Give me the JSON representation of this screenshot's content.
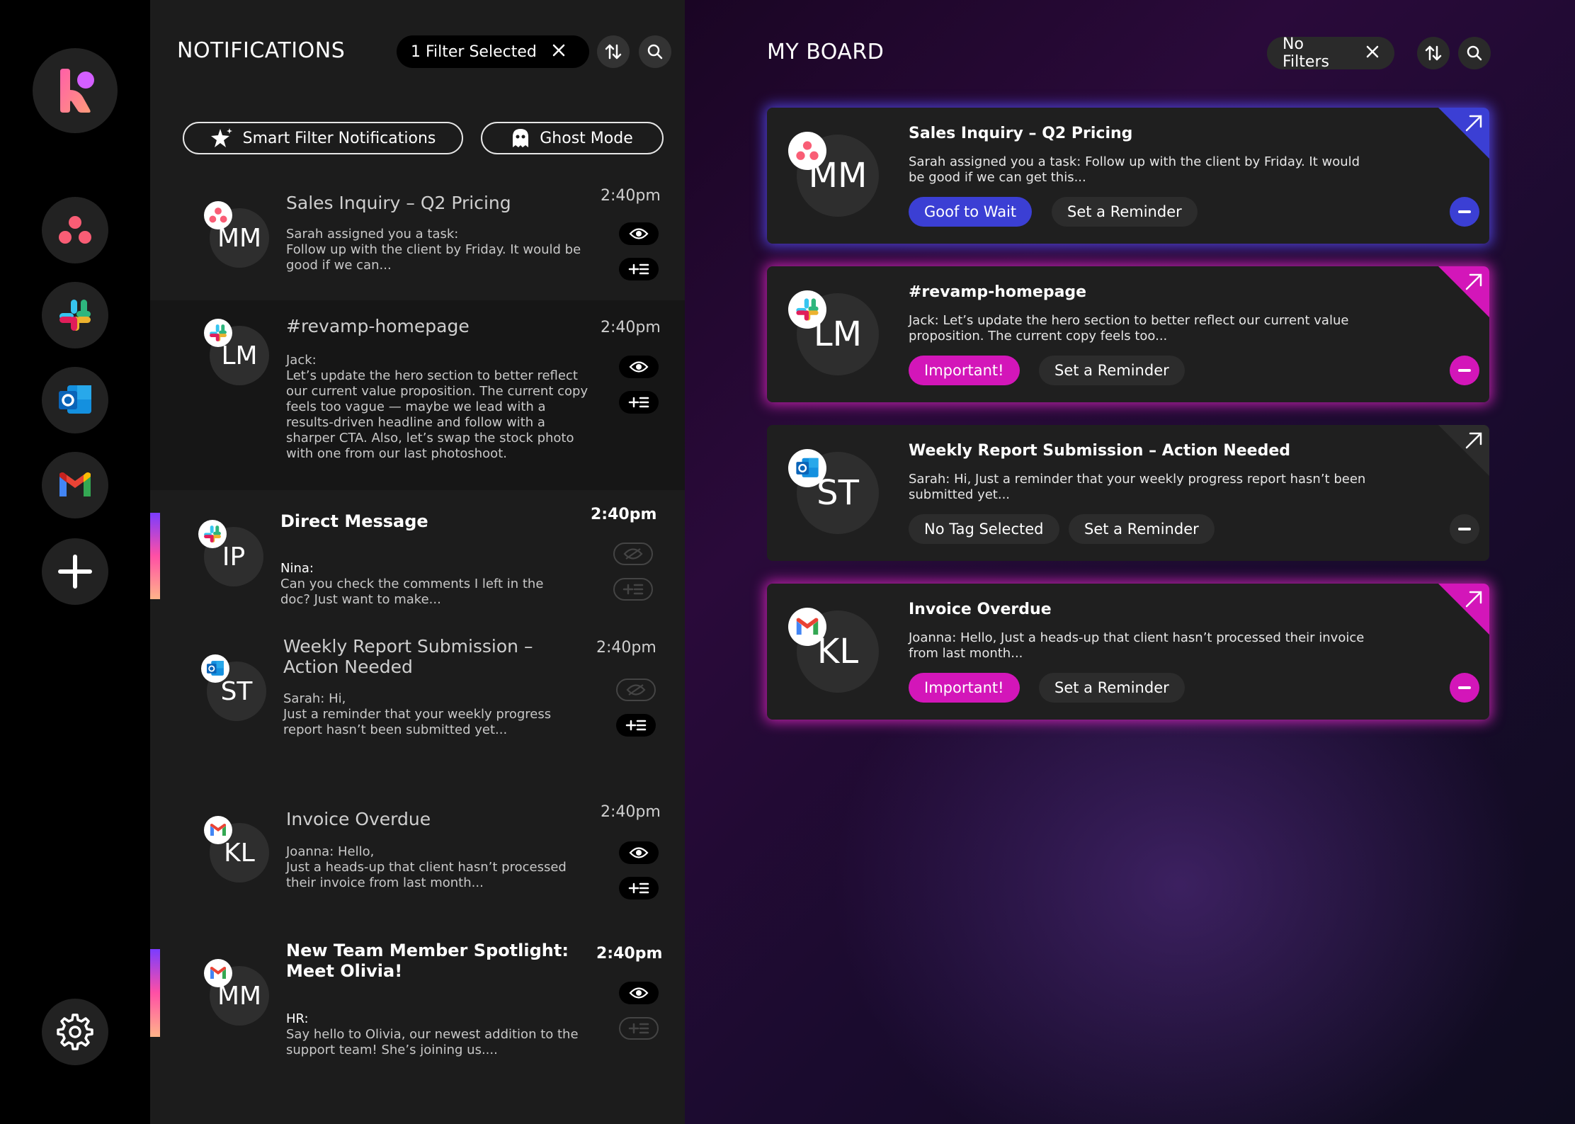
{
  "rail": {
    "apps": [
      "asana-icon",
      "slack-icon",
      "outlook-icon",
      "gmail-icon",
      "plus-icon"
    ],
    "settings_icon": "gear-icon"
  },
  "notifications": {
    "title": "NOTIFICATIONS",
    "filter_label": "1 Filter Selected",
    "smart_filter_label": "Smart Filter Notifications",
    "ghost_mode_label": "Ghost Mode",
    "items": [
      {
        "title": "Sales Inquiry – Q2 Pricing",
        "time": "2:40pm",
        "initials": "MM",
        "app": "asana",
        "body": "Sarah assigned you a task:\nFollow up with the client by Friday. It would be good if we can..."
      },
      {
        "title": "#revamp-homepage",
        "time": "2:40pm",
        "initials": "LM",
        "app": "slack",
        "body": "Jack:\nLet’s update the hero section to better reflect our current value proposition. The current copy feels too vague — maybe we lead with a results-driven headline and follow with a sharper CTA. Also, let’s swap the stock photo with one from our last photoshoot."
      },
      {
        "title": "Direct Message",
        "time": "2:40pm",
        "initials": "IP",
        "app": "slack",
        "sender": "Nina:",
        "body": "Can you check the comments I left in the doc? Just want to make..."
      },
      {
        "title": "Weekly Report Submission – Action Needed",
        "time": "2:40pm",
        "initials": "ST",
        "app": "outlook",
        "body": "Sarah: Hi,\nJust a reminder that your weekly progress report hasn’t been submitted yet..."
      },
      {
        "title": "Invoice Overdue",
        "time": "2:40pm",
        "initials": "KL",
        "app": "gmail",
        "body": "Joanna: Hello,\nJust a heads-up that client hasn’t processed their invoice from last month..."
      },
      {
        "title": "New Team Member Spotlight: Meet Olivia!",
        "time": "2:40pm",
        "initials": "MM",
        "app": "gmail",
        "sender": "HR:",
        "body": "Say hello to Olivia, our newest addition to the support team! She’s joining us...."
      }
    ]
  },
  "board": {
    "title": "MY BOARD",
    "filter_label": "No Filters",
    "cards": [
      {
        "title": "Sales Inquiry – Q2 Pricing",
        "initials": "MM",
        "app": "asana",
        "body": "Sarah assigned you a task: Follow up with the client by Friday. It would be good if we can get this...",
        "tag": "Goof to Wait",
        "reminder": "Set a Reminder",
        "accent": "#3b3fd4"
      },
      {
        "title": "#revamp-homepage",
        "initials": "LM",
        "app": "slack",
        "body": "Jack: Let’s update the hero section to better reflect our current value proposition. The current copy feels too...",
        "tag": "Important!",
        "reminder": "Set a Reminder",
        "accent": "#d316b9"
      },
      {
        "title": "Weekly Report Submission – Action Needed",
        "initials": "ST",
        "app": "outlook",
        "body": "Sarah: Hi, Just a reminder that your weekly progress report hasn’t been submitted yet...",
        "tag": "No Tag Selected",
        "reminder": "Set a Reminder",
        "accent": "#2c2c2c"
      },
      {
        "title": "Invoice Overdue",
        "initials": "KL",
        "app": "gmail",
        "body": "Joanna: Hello, Just a heads-up that client hasn’t processed their invoice from last month...",
        "tag": "Important!",
        "reminder": "Set a Reminder",
        "accent": "#d316b9"
      }
    ]
  }
}
